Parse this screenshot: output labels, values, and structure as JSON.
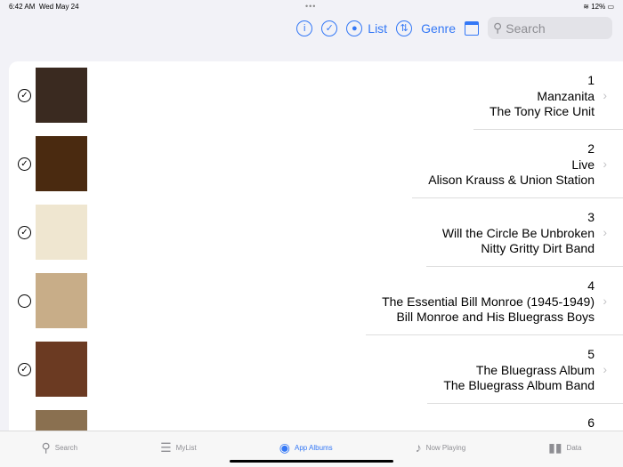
{
  "status": {
    "time": "6:42 AM",
    "date": "Wed May 24",
    "battery": "12%"
  },
  "toolbar": {
    "list_label": "List",
    "genre_label": "Genre",
    "search_placeholder": "Search"
  },
  "albums": [
    {
      "num": "1",
      "title": "Manzanita",
      "artist": "The Tony Rice Unit",
      "checked": true,
      "color": "#3a2a20"
    },
    {
      "num": "2",
      "title": "Live",
      "artist": "Alison Krauss & Union Station",
      "checked": true,
      "color": "#4a2a10"
    },
    {
      "num": "3",
      "title": "Will the Circle Be Unbroken",
      "artist": "Nitty Gritty Dirt Band",
      "checked": true,
      "color": "#efe6d0"
    },
    {
      "num": "4",
      "title": "The Essential Bill Monroe (1945-1949)",
      "artist": "Bill Monroe and His Bluegrass Boys",
      "checked": false,
      "color": "#c8ad88"
    },
    {
      "num": "5",
      "title": "The Bluegrass Album",
      "artist": "The Bluegrass Album Band",
      "checked": true,
      "color": "#6b3a22"
    },
    {
      "num": "6",
      "title": "",
      "artist": "",
      "checked": false,
      "color": "#8a7050"
    }
  ],
  "tabs": [
    {
      "label": "Search",
      "icon": "search-icon"
    },
    {
      "label": "MyList",
      "icon": "list-icon"
    },
    {
      "label": "App Albums",
      "icon": "album-icon"
    },
    {
      "label": "Now Playing",
      "icon": "music-note-icon"
    },
    {
      "label": "Data",
      "icon": "chart-icon"
    }
  ]
}
